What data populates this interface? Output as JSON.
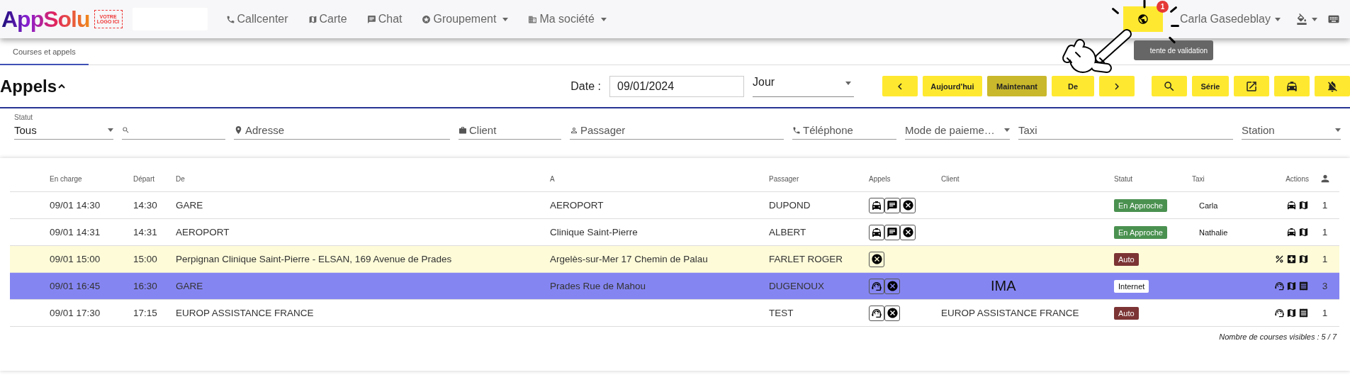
{
  "logo": {
    "text": "AppSolu",
    "stamp": "VOTRE LOGO ICI"
  },
  "nav": [
    {
      "kind": "phone",
      "label": "Callcenter",
      "dropdown": false
    },
    {
      "kind": "map",
      "label": "Carte",
      "dropdown": false
    },
    {
      "kind": "chat",
      "label": "Chat",
      "dropdown": false
    },
    {
      "kind": "group",
      "label": "Groupement",
      "dropdown": true
    },
    {
      "kind": "company",
      "label": "Ma société",
      "dropdown": true
    }
  ],
  "notifications": {
    "badge": "1",
    "tooltip": "tente de validation"
  },
  "user": {
    "name": "Carla Gasedeblay"
  },
  "tabs": [
    {
      "label": "Courses et appels",
      "selected": true
    }
  ],
  "header": {
    "title": "Appels",
    "date_label": "Date :",
    "date": "09/01/2024",
    "period": "Jour"
  },
  "toolbar": [
    {
      "kind": "prev",
      "selected": false
    },
    {
      "kind": "text",
      "label": "Aujourd'hui",
      "selected": false
    },
    {
      "kind": "text",
      "label": "Maintenant",
      "selected": true
    },
    {
      "kind": "text",
      "label": "De",
      "selected": false
    },
    {
      "kind": "next",
      "selected": false
    },
    {
      "kind": "search",
      "selected": false
    },
    {
      "kind": "text",
      "label": "Série",
      "selected": false
    },
    {
      "kind": "open",
      "selected": false
    },
    {
      "kind": "taxi",
      "selected": false
    },
    {
      "kind": "mute",
      "selected": false
    }
  ],
  "filters": [
    {
      "kind": "select",
      "label": "Statut",
      "value": "Tous"
    },
    {
      "kind": "search"
    },
    {
      "kind": "address",
      "placeholder": "Adresse"
    },
    {
      "kind": "client",
      "placeholder": "Client"
    },
    {
      "kind": "passenger",
      "placeholder": "Passager"
    },
    {
      "kind": "phone",
      "placeholder": "Téléphone"
    },
    {
      "kind": "select",
      "placeholder": "Mode de paieme…"
    },
    {
      "kind": "text",
      "placeholder": "Taxi"
    },
    {
      "kind": "select",
      "placeholder": "Station"
    }
  ],
  "table": {
    "columns": [
      "En charge",
      "Départ",
      "De",
      "A",
      "Passager",
      "Appels",
      "Client",
      "Statut",
      "Taxi",
      "Actions"
    ],
    "rows": [
      {
        "en_charge": "09/01 14:30",
        "depart": "14:30",
        "de": "GARE",
        "a": "AEROPORT",
        "passager": "DUPOND",
        "appels": [
          {
            "kind": "taxi"
          },
          {
            "kind": "chat"
          },
          {
            "kind": "cancel"
          }
        ],
        "statut": {
          "label": "En Approche",
          "color": "#4a9150"
        },
        "taxi": "Carla",
        "actions": [
          {
            "kind": "taxi"
          },
          {
            "kind": "map"
          }
        ],
        "count": "1",
        "highlighted": false,
        "selected": false
      },
      {
        "en_charge": "09/01 14:31",
        "depart": "14:31",
        "de": "AEROPORT",
        "a": "Clinique Saint-Pierre",
        "passager": "ALBERT",
        "appels": [
          {
            "kind": "taxi"
          },
          {
            "kind": "chat"
          },
          {
            "kind": "cancel"
          }
        ],
        "statut": {
          "label": "En Approche",
          "color": "#4a9150"
        },
        "taxi": "Nathalie",
        "actions": [
          {
            "kind": "taxi"
          },
          {
            "kind": "map"
          }
        ],
        "count": "1",
        "highlighted": false,
        "selected": false
      },
      {
        "en_charge": "09/01 15:00",
        "depart": "15:00",
        "de": "Perpignan Clinique Saint-Pierre - ELSAN, 169 Avenue de Prades",
        "a": "Argelès-sur-Mer 17 Chemin de Palau",
        "passager": "FARLET ROGER",
        "appels": [
          {
            "kind": "cancel"
          }
        ],
        "statut": {
          "label": "Auto",
          "color": "#7c3434"
        },
        "actions": [
          {
            "kind": "percent"
          },
          {
            "kind": "medical"
          },
          {
            "kind": "map"
          }
        ],
        "count": "1",
        "highlighted": true,
        "selected": false
      },
      {
        "en_charge": "09/01 16:45",
        "depart": "16:30",
        "de": "GARE",
        "a": "Prades Rue de Mahou",
        "passager": "DUGENOUX",
        "appels": [
          {
            "kind": "operator"
          },
          {
            "kind": "cancel"
          }
        ],
        "client": "IMA",
        "client_large": true,
        "statut": {
          "label": "Internet",
          "color": "#ffffff"
        },
        "actions": [
          {
            "kind": "operator"
          },
          {
            "kind": "map"
          },
          {
            "kind": "list"
          }
        ],
        "count": "3",
        "highlighted": false,
        "selected": true
      },
      {
        "en_charge": "09/01 17:30",
        "depart": "17:15",
        "de": "EUROP ASSISTANCE FRANCE",
        "passager": "TEST",
        "appels": [
          {
            "kind": "operator"
          },
          {
            "kind": "cancel"
          }
        ],
        "client": "EUROP ASSISTANCE FRANCE",
        "client_large": false,
        "statut": {
          "label": "Auto",
          "color": "#7c3434"
        },
        "actions": [
          {
            "kind": "operator"
          },
          {
            "kind": "map"
          },
          {
            "kind": "list"
          }
        ],
        "count": "1",
        "highlighted": false,
        "selected": false
      }
    ],
    "footer": "Nombre de courses visibles : 5 / 7"
  }
}
